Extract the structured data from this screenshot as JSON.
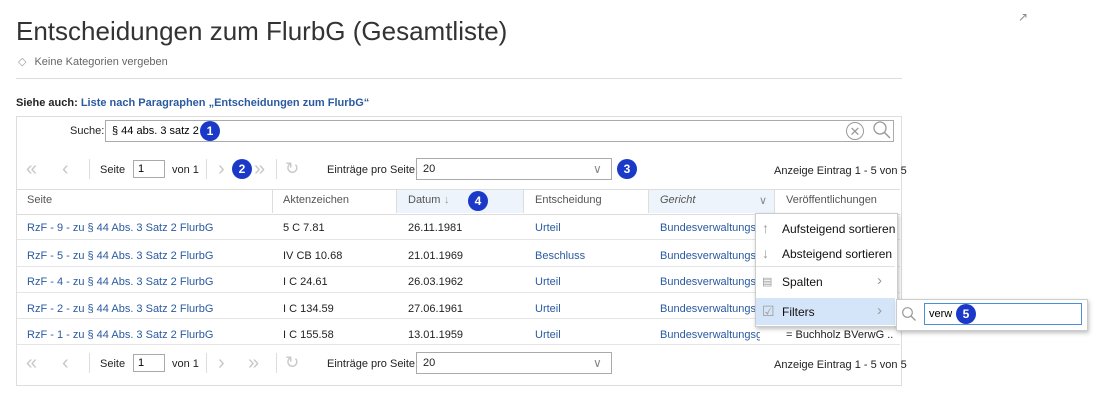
{
  "page": {
    "title": "Entscheidungen zum FlurbG (Gesamtliste)",
    "categories_text": "Keine Kategorien vergeben",
    "see_also_label": "Siehe auch:",
    "see_also_link": "Liste nach Paragraphen „Entscheidungen zum FlurbG“"
  },
  "search": {
    "label": "Suche:",
    "value": "§ 44 abs. 3 satz 2"
  },
  "pager": {
    "page_label": "Seite",
    "page_value": "1",
    "of_label": "von 1",
    "per_page_label": "Einträge pro Seite:",
    "per_page_value": "20",
    "summary": "Anzeige Eintrag 1 - 5 von 5"
  },
  "badges": [
    "1",
    "2",
    "3",
    "4",
    "5"
  ],
  "columns": [
    "Seite",
    "Aktenzeichen",
    "Datum",
    "Entscheidung",
    "Gericht",
    "Veröffentlichungen"
  ],
  "rows": [
    {
      "seite": "RzF - 9 - zu § 44 Abs. 3 Satz 2 FlurbG",
      "az": "5 C 7.81",
      "datum": "26.11.1981",
      "entscheidung": "Urteil",
      "gericht": "Bundesverwaltungsg...",
      "veroeff": ""
    },
    {
      "seite": "RzF - 5 - zu § 44 Abs. 3 Satz 2 FlurbG",
      "az": "IV CB 10.68",
      "datum": "21.01.1969",
      "entscheidung": "Beschluss",
      "gericht": "Bundesverwaltungsg...",
      "veroeff": ""
    },
    {
      "seite": "RzF - 4 - zu § 44 Abs. 3 Satz 2 FlurbG",
      "az": "I C 24.61",
      "datum": "26.03.1962",
      "entscheidung": "Urteil",
      "gericht": "Bundesverwaltungsg...",
      "veroeff": ""
    },
    {
      "seite": "RzF - 2 - zu § 44 Abs. 3 Satz 2 FlurbG",
      "az": "I C 134.59",
      "datum": "27.06.1961",
      "entscheidung": "Urteil",
      "gericht": "Bundesverwaltungsg...",
      "veroeff": ""
    },
    {
      "seite": "RzF - 1 - zu § 44 Abs. 3 Satz 2 FlurbG",
      "az": "I C 155.58",
      "datum": "13.01.1959",
      "entscheidung": "Urteil",
      "gericht": "Bundesverwaltungsg...",
      "veroeff": "= Buchholz BVerwG ..."
    }
  ],
  "column_menu": {
    "sort_asc": "Aufsteigend sortieren",
    "sort_desc": "Absteigend sortieren",
    "columns": "Spalten",
    "filters": "Filters",
    "filter_value": "verw"
  },
  "colors": {
    "link": "#2a5aa0",
    "badge": "#1b39c8",
    "menu_active": "#d5e5f9"
  }
}
